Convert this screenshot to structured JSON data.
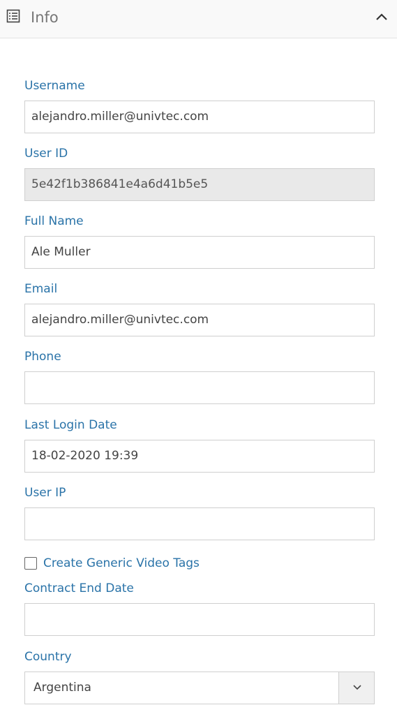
{
  "header": {
    "icon": "list-icon",
    "title": "Info",
    "collapse_icon": "chevron-up-icon"
  },
  "form": {
    "username": {
      "label": "Username",
      "value": "alejandro.miller@univtec.com"
    },
    "user_id": {
      "label": "User ID",
      "value": "5e42f1b386841e4a6d41b5e5"
    },
    "full_name": {
      "label": "Full Name",
      "value": "Ale Muller"
    },
    "email": {
      "label": "Email",
      "value": "alejandro.miller@univtec.com"
    },
    "phone": {
      "label": "Phone",
      "value": ""
    },
    "last_login_date": {
      "label": "Last Login Date",
      "value": "18-02-2020 19:39"
    },
    "user_ip": {
      "label": "User IP",
      "value": ""
    },
    "create_generic_video_tags": {
      "label": "Create Generic Video Tags",
      "checked": false
    },
    "contract_end_date": {
      "label": "Contract End Date",
      "value": ""
    },
    "country": {
      "label": "Country",
      "value": "Argentina",
      "dropdown_icon": "chevron-down-icon"
    }
  },
  "colors": {
    "label": "#2a73a8",
    "readonly_bg": "#e9e9e9",
    "border": "#cfcfcf"
  }
}
